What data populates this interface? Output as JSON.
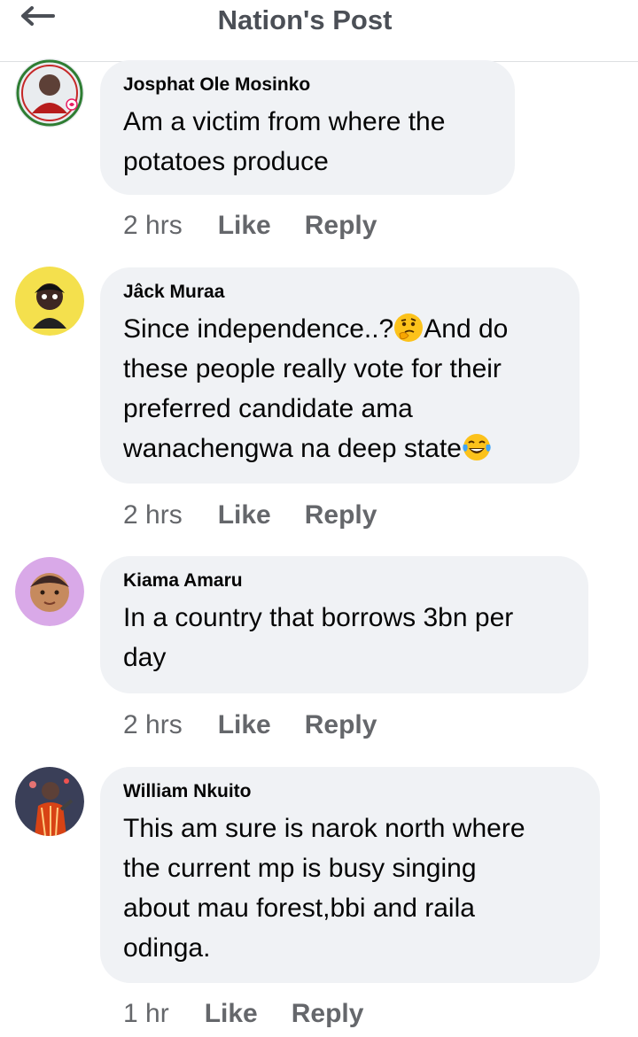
{
  "header": {
    "title": "Nation's Post",
    "back_icon": "arrow-left-icon"
  },
  "comments": [
    {
      "author": "Josphat Ole Mosinko",
      "text": "Am a victim from where the\npotatoes produce",
      "time": "2 hrs",
      "like_label": "Like",
      "reply_label": "Reply"
    },
    {
      "author": "Jâck Muraa",
      "text_parts": [
        "Since independence..?",
        "And do\nthese people really vote for their\npreferred candidate ama\nwanachengwa na deep state",
        ""
      ],
      "emojis": [
        "thinking-face-emoji",
        "tears-of-joy-emoji"
      ],
      "time": "2 hrs",
      "like_label": "Like",
      "reply_label": "Reply"
    },
    {
      "author": "Kiama Amaru",
      "text": "In a country that borrows 3bn per\nday",
      "time": "2 hrs",
      "like_label": "Like",
      "reply_label": "Reply"
    },
    {
      "author": "William Nkuito",
      "text": "This am sure is narok north where\nthe current mp is busy singing\nabout mau forest,bbi and raila\nodinga.",
      "time": "1 hr",
      "like_label": "Like",
      "reply_label": "Reply"
    }
  ],
  "colors": {
    "bubble": "#f0f2f5",
    "meta_text": "#65676b",
    "title_text": "#4b4f56"
  }
}
